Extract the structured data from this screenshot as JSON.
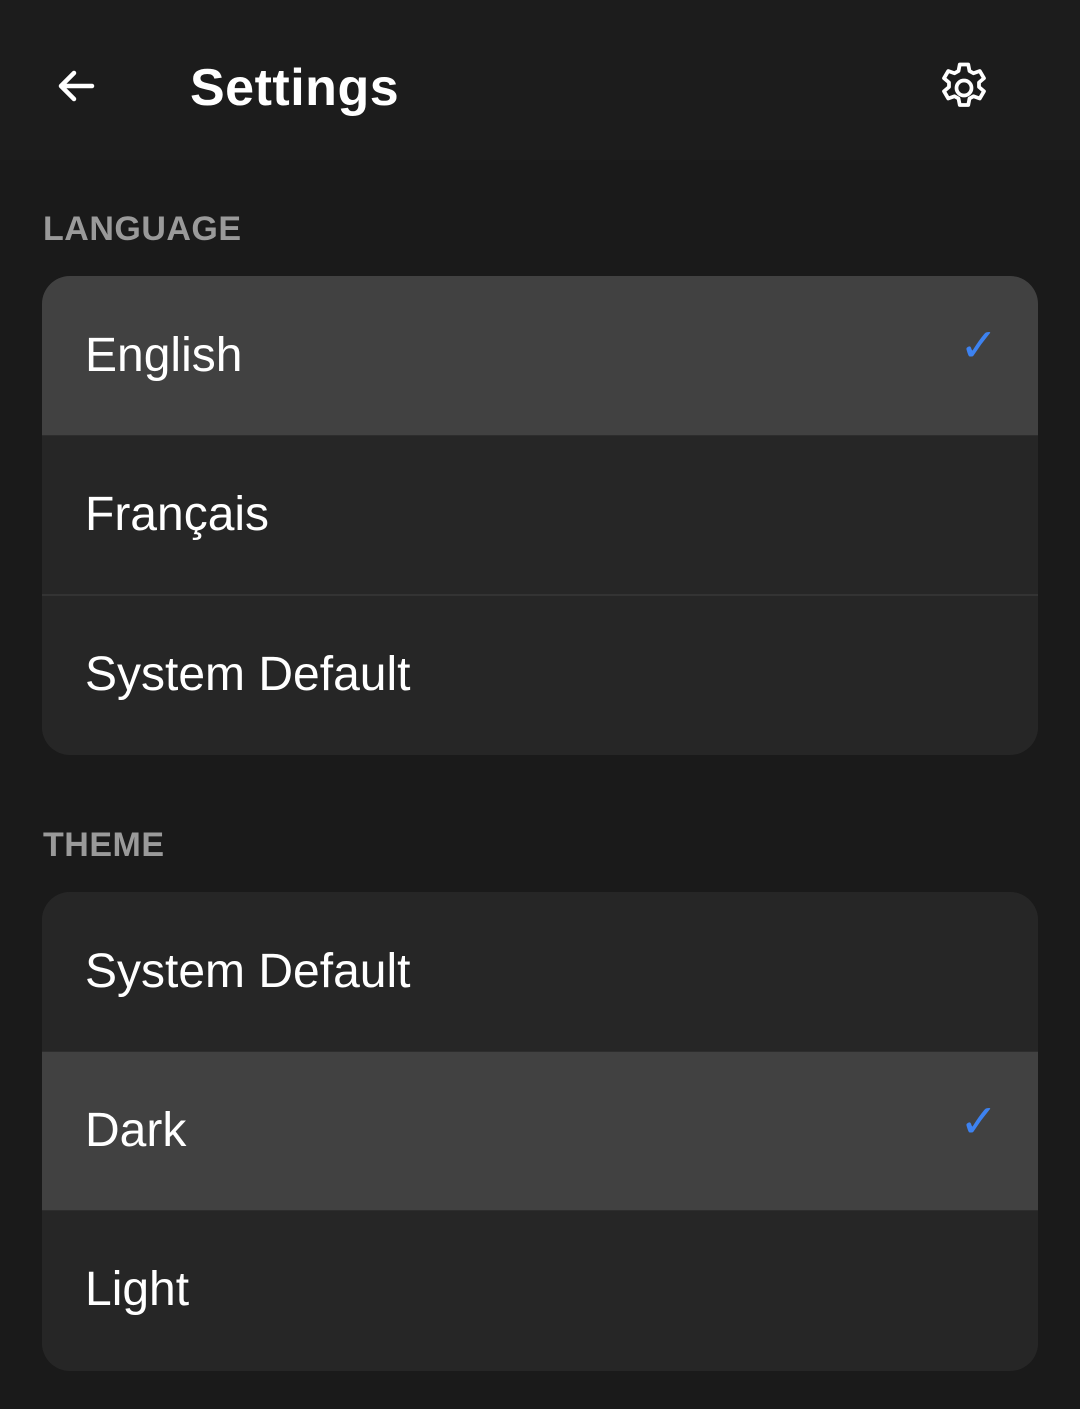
{
  "header": {
    "title": "Settings",
    "back_icon": "arrow-left-icon",
    "settings_icon": "gear-icon"
  },
  "language": {
    "header": "LANGUAGE",
    "items": [
      {
        "label": "English",
        "selected": true
      },
      {
        "label": "Français",
        "selected": false
      },
      {
        "label": "System Default",
        "selected": false
      }
    ]
  },
  "theme": {
    "header": "THEME",
    "items": [
      {
        "label": "System Default",
        "selected": false
      },
      {
        "label": "Dark",
        "selected": true
      },
      {
        "label": "Light",
        "selected": false
      }
    ]
  },
  "check_glyph": "✓",
  "colors": {
    "background": "#1a1a1a",
    "card": "#262626",
    "selected_row": "#414141",
    "section_header": "#9a9a9a",
    "accent_check": "#3d82f0"
  }
}
